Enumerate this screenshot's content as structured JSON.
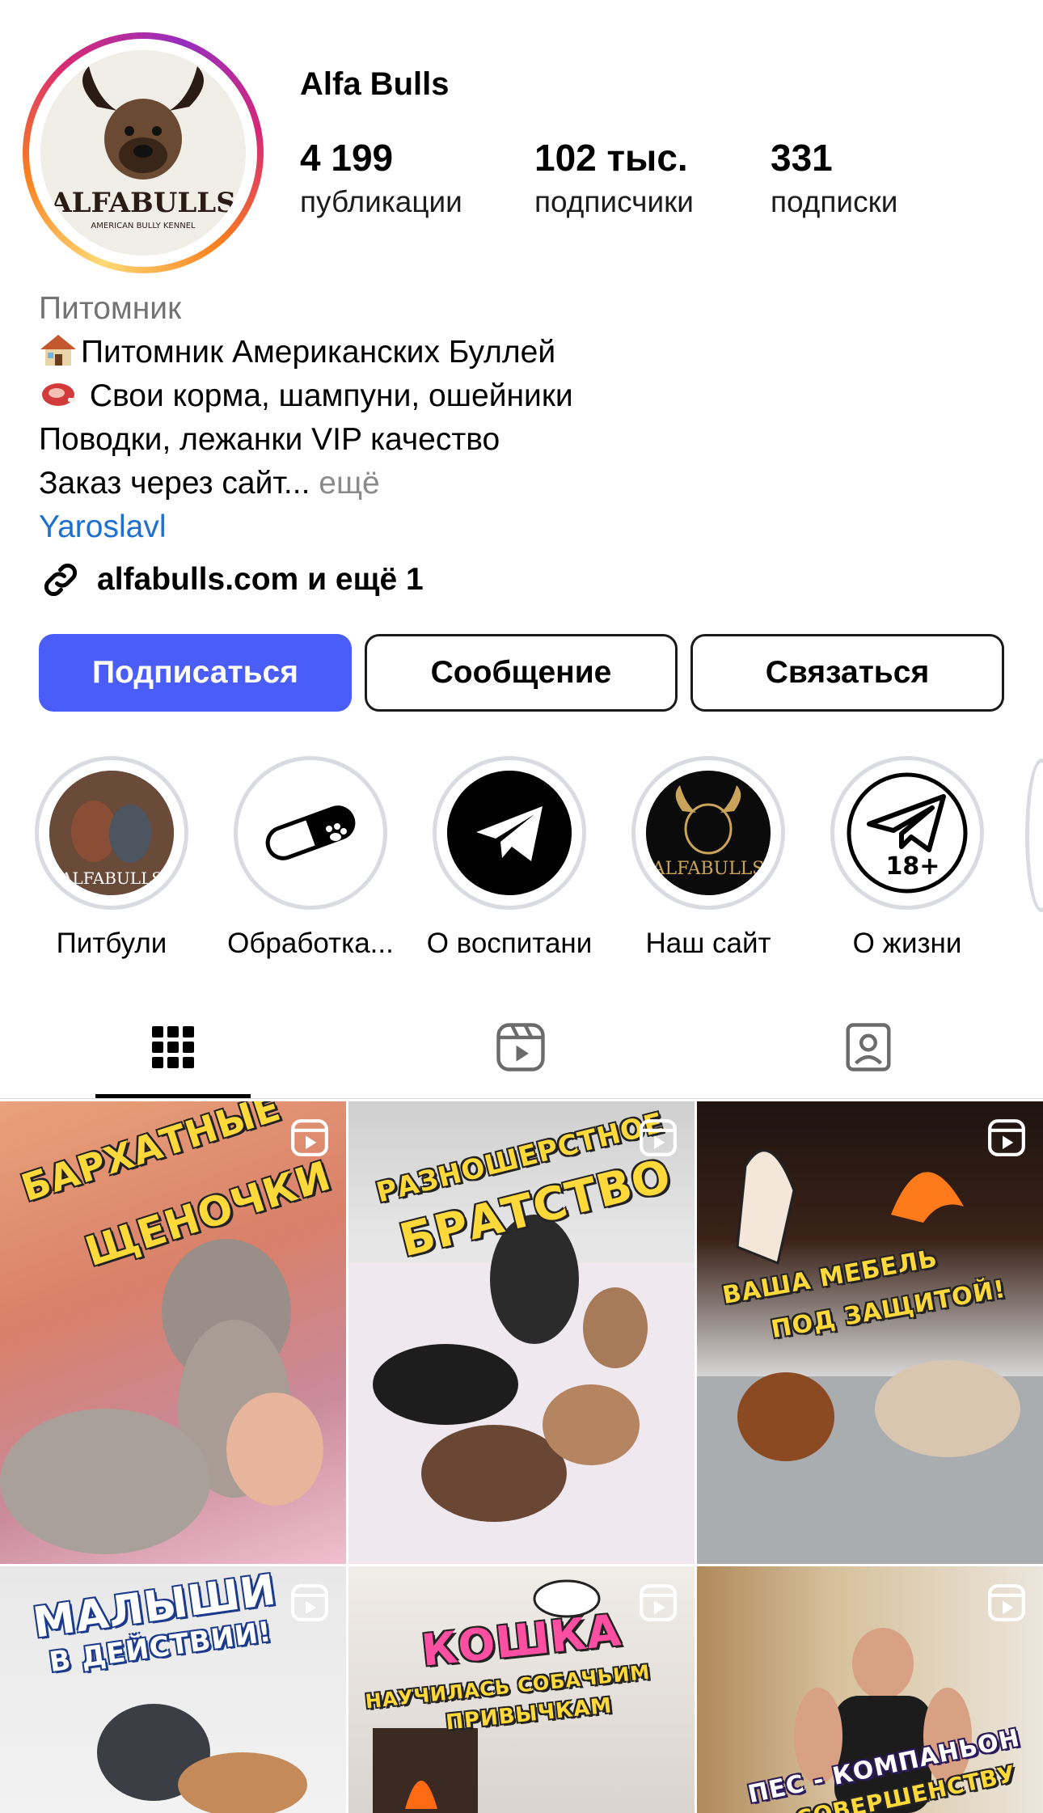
{
  "profile": {
    "name": "Alfa Bulls",
    "avatar_text": "ALFABULLS",
    "avatar_subtext": "AMERICAN BULLY KENNEL"
  },
  "stats": [
    {
      "value": "4 199",
      "label": "публикации"
    },
    {
      "value": "102 тыс.",
      "label": "подписчики"
    },
    {
      "value": "331",
      "label": "подписки"
    }
  ],
  "bio": {
    "category": "Питомник",
    "line1": "Питомник Американских Буллей",
    "line2": " Свои корма, шампуни, ошейники",
    "line3": "Поводки, лежанки VIP качество",
    "line4": "Заказ через сайт...",
    "more": "ещё",
    "location": "Yaroslavl"
  },
  "link": {
    "text": "alfabulls.com и ещё 1"
  },
  "buttons": {
    "follow": "Подписаться",
    "message": "Сообщение",
    "contact": "Связаться"
  },
  "highlights": [
    {
      "label": "Питбули",
      "icon": "dogs-photo"
    },
    {
      "label": "Обработка...",
      "icon": "pill-paw-icon"
    },
    {
      "label": "О воспитани",
      "icon": "telegram-icon"
    },
    {
      "label": "Наш сайт",
      "icon": "logo"
    },
    {
      "label": "О жизни",
      "icon": "telegram-18-icon",
      "badge": "18+"
    }
  ],
  "tabs": [
    "grid-icon",
    "reels-icon",
    "tagged-icon"
  ],
  "posts": [
    {
      "caption1": "БАРХАТНЫЕ",
      "caption2": "ЩЕНОЧКИ"
    },
    {
      "caption1": "РАЗНОШЕРСТНОЕ",
      "caption2": "БРАТСТВО"
    },
    {
      "caption1": "ВАША МЕБЕЛЬ",
      "caption2": "ПОД ЗАЩИТОЙ!"
    },
    {
      "caption1": "МАЛЫШИ",
      "caption2": "В ДЕЙСТВИИ!"
    },
    {
      "caption1": "КОШКА",
      "caption2": "НАУЧИЛАСЬ СОБАЧЬИМ",
      "caption3": "ПРИВЫЧКАМ"
    },
    {
      "caption1": "ПЕС - КОМПАНЬОН",
      "caption2": "СОВЕРШЕНСТВУ"
    }
  ],
  "colors": {
    "primary_button": "#4a5df9",
    "link": "#1f6fd1",
    "muted": "#737373"
  }
}
